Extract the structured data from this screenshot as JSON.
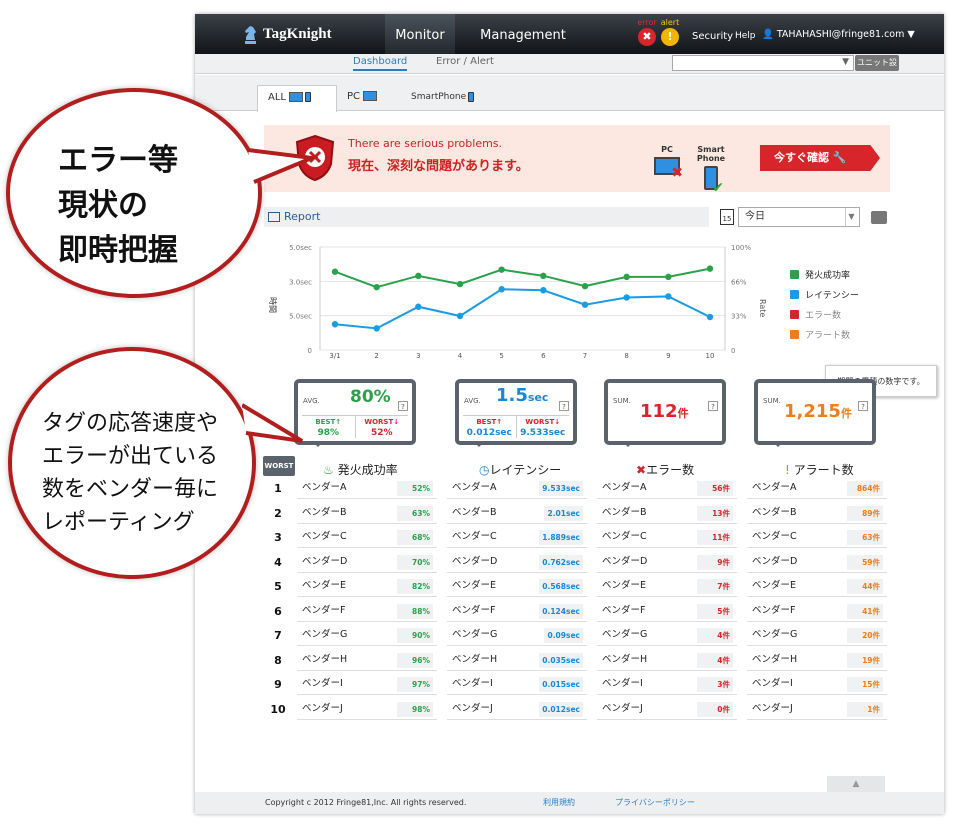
{
  "app": {
    "name": "TagKnight"
  },
  "nav": {
    "monitor": "Monitor",
    "management": "Management",
    "error_label": "error",
    "alert_label": "alert",
    "security": "Security",
    "help": "Help",
    "user": "TAHAHASHI@fringe81.com ▼"
  },
  "subnav": {
    "dashboard": "Dashboard",
    "error_alert": "Error / Alert",
    "unit_button": "ユニット設定"
  },
  "device_tabs": {
    "all": "ALL",
    "pc": "PC",
    "smartphone": "SmartPhone"
  },
  "banner": {
    "en": "There are serious problems.",
    "jp": "現在、深刻な問題があります。",
    "pc": "PC",
    "smartphone": "Smart Phone",
    "confirm": "今すぐ確認"
  },
  "report": {
    "title": "Report",
    "date": "今日",
    "cal_day": "15"
  },
  "chart_data": {
    "type": "line",
    "x": [
      "3/1",
      "2",
      "3",
      "4",
      "5",
      "6",
      "7",
      "8",
      "9",
      "10"
    ],
    "left_ticks": [
      "5.0sec",
      "3.0sec",
      "5.0sec",
      "0"
    ],
    "right_ticks": [
      "100%",
      "66%",
      "33%",
      "0"
    ],
    "ylabel_left": "時間",
    "ylabel_right": "Rate",
    "series": [
      {
        "name": "発火成功率",
        "color": "#2aa14a",
        "values": [
          76,
          61,
          72,
          64,
          78,
          72,
          62,
          71,
          71,
          79
        ]
      },
      {
        "name": "レイテンシー",
        "color": "#1a9be3",
        "values": [
          25,
          21,
          42,
          33,
          59,
          58,
          44,
          51,
          52,
          32
        ]
      }
    ],
    "ylim": [
      0,
      100
    ],
    "legend": [
      {
        "label": "発火成功率",
        "color": "#2aa14a",
        "active": true
      },
      {
        "label": "レイテンシー",
        "color": "#1a9be3",
        "active": true
      },
      {
        "label": "エラー数",
        "color": "#d8252b",
        "active": false
      },
      {
        "label": "アラート数",
        "color": "#ef7d1a",
        "active": false
      }
    ]
  },
  "tooltip": "期間の累積の数字です。",
  "stats": {
    "success": {
      "label": "AVG.",
      "value": "80%",
      "best_label": "BEST↑",
      "best": "98%",
      "worst_label": "WORST↓",
      "worst": "52%"
    },
    "latency": {
      "label": "AVG.",
      "value": "1.5",
      "unit": "sec",
      "best_label": "BEST↑",
      "best": "0.012sec",
      "worst_label": "WORST↓",
      "worst": "9.533sec"
    },
    "error": {
      "label": "SUM.",
      "value": "112",
      "unit": "件"
    },
    "alert": {
      "label": "SUM.",
      "value": "1,215",
      "unit": "件"
    }
  },
  "worst_label": "WORST",
  "columns": {
    "success": "発火成功率",
    "latency": "レイテンシー",
    "error": "エラー数",
    "alert": "アラート数"
  },
  "ranks": [
    "1",
    "2",
    "3",
    "4",
    "5",
    "6",
    "7",
    "8",
    "9",
    "10"
  ],
  "vendors": [
    "ベンダーA",
    "ベンダーB",
    "ベンダーC",
    "ベンダーD",
    "ベンダーE",
    "ベンダーF",
    "ベンダーG",
    "ベンダーH",
    "ベンダーI",
    "ベンダーJ"
  ],
  "success_values": [
    "52%",
    "63%",
    "68%",
    "70%",
    "82%",
    "88%",
    "90%",
    "96%",
    "97%",
    "98%"
  ],
  "latency_values": [
    "9.533sec",
    "2.01sec",
    "1.889sec",
    "0.762sec",
    "0.568sec",
    "0.124sec",
    "0.09sec",
    "0.035sec",
    "0.015sec",
    "0.012sec"
  ],
  "error_values": [
    "56件",
    "13件",
    "11件",
    "9件",
    "7件",
    "5件",
    "4件",
    "4件",
    "3件",
    "0件"
  ],
  "alert_values": [
    "864件",
    "89件",
    "63件",
    "59件",
    "44件",
    "41件",
    "20件",
    "19件",
    "15件",
    "1件"
  ],
  "footer": {
    "copyright": "Copyright c 2012 Fringe81,Inc. All rights reserved.",
    "terms": "利用規約",
    "privacy": "プライバシーポリシー"
  },
  "callout1": [
    "エラー等",
    "現状の",
    "即時把握"
  ],
  "callout2": [
    "タグの応答速度や",
    "エラーが出ている",
    "数をベンダー毎に",
    "レポーティング"
  ]
}
